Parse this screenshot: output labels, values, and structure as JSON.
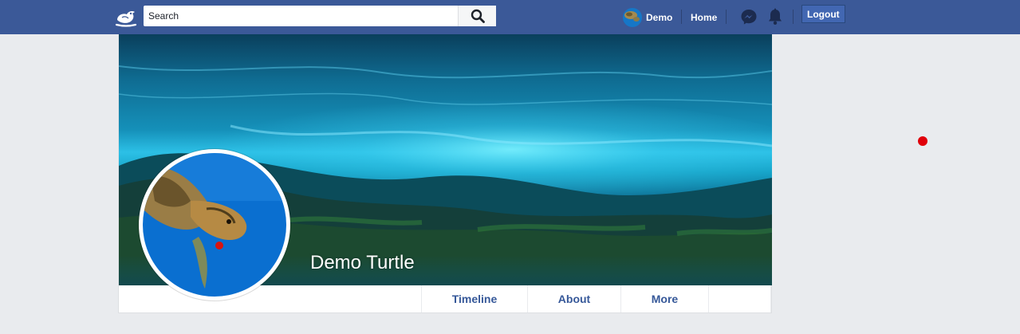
{
  "topbar": {
    "logo_icon": "bird-logo-icon",
    "search": {
      "placeholder": "Search",
      "value": ""
    },
    "user_name": "Demo",
    "home_label": "Home",
    "messenger_icon": "messenger-icon",
    "notifications_icon": "bell-icon",
    "logout_label": "Logout"
  },
  "profile": {
    "name": "Demo Turtle",
    "tabs": [
      {
        "label": "Timeline"
      },
      {
        "label": "About"
      },
      {
        "label": "More"
      }
    ]
  },
  "colors": {
    "header": "#3b5998",
    "tab_text": "#365899",
    "page_bg": "#e9ebee",
    "cursor_marker": "#e0000a"
  }
}
